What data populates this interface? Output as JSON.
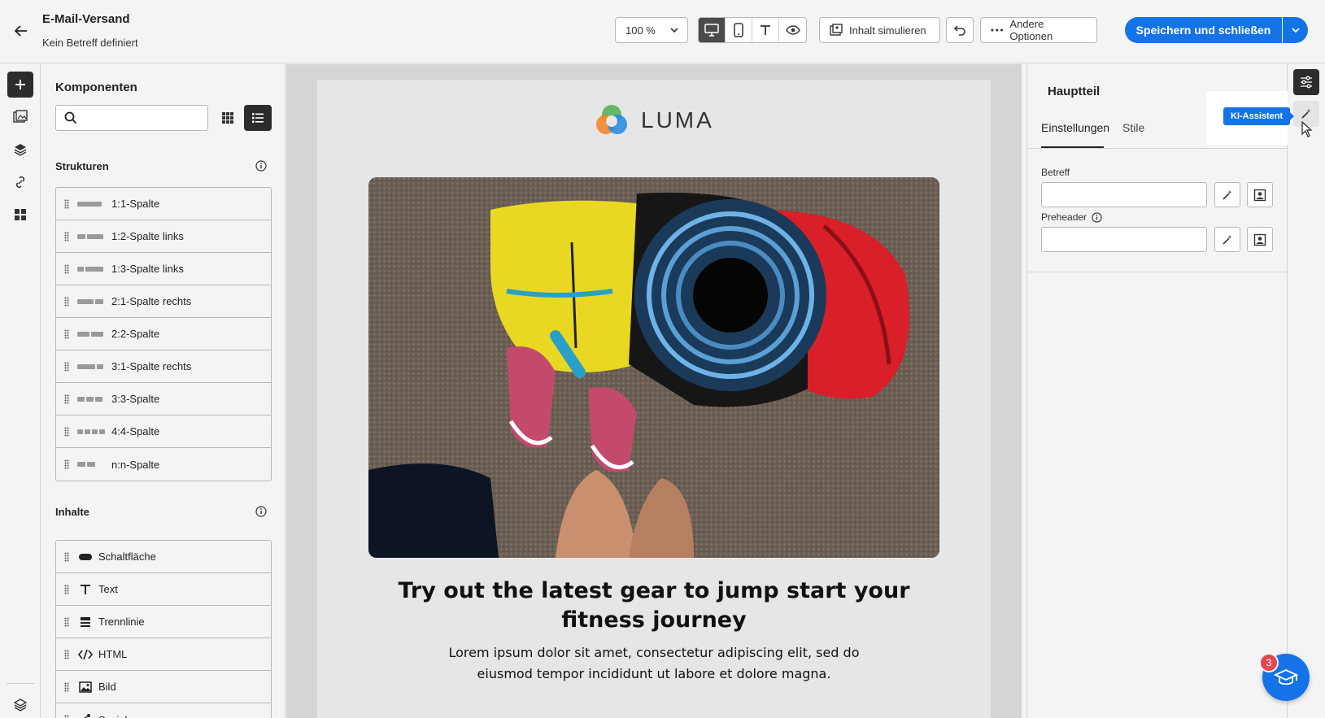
{
  "header": {
    "title": "E-Mail-Versand",
    "subtitle": "Kein Betreff definiert",
    "zoom": "100 %",
    "simulate_label": "Inhalt simulieren",
    "more_options_label": "Andere Optionen",
    "save_label": "Speichern und schließen"
  },
  "components": {
    "title": "Komponenten",
    "search_placeholder": "",
    "structures_heading": "Strukturen",
    "structures": [
      {
        "label": "1:1-Spalte",
        "bars": [
          30
        ]
      },
      {
        "label": "1:2-Spalte links",
        "bars": [
          10,
          20
        ]
      },
      {
        "label": "1:3-Spalte links",
        "bars": [
          8,
          22
        ]
      },
      {
        "label": "2:1-Spalte rechts",
        "bars": [
          20,
          10
        ]
      },
      {
        "label": "2:2-Spalte",
        "bars": [
          15,
          15
        ]
      },
      {
        "label": "3:1-Spalte rechts",
        "bars": [
          22,
          8
        ]
      },
      {
        "label": "3:3-Spalte",
        "bars": [
          9,
          9,
          9
        ]
      },
      {
        "label": "4:4-Spalte",
        "bars": [
          7,
          7,
          7,
          7
        ]
      },
      {
        "label": "n:n-Spalte",
        "bars": [
          10,
          10
        ]
      }
    ],
    "contents_heading": "Inhalte",
    "contents": [
      {
        "label": "Schaltfläche",
        "icon": "button-icon"
      },
      {
        "label": "Text",
        "icon": "text-icon"
      },
      {
        "label": "Trennlinie",
        "icon": "divider-icon"
      },
      {
        "label": "HTML",
        "icon": "html-icon"
      },
      {
        "label": "Bild",
        "icon": "image-icon"
      },
      {
        "label": "Social",
        "icon": "social-icon"
      }
    ]
  },
  "email": {
    "logo_text": "LUMA",
    "headline": "Try out the latest gear to jump start your fitness journey",
    "body": "Lorem ipsum dolor sit amet, consectetur adipiscing elit, sed do eiusmod tempor incididunt ut labore et dolore magna."
  },
  "properties": {
    "title": "Hauptteil",
    "tabs": [
      "Einstellungen",
      "Stile"
    ],
    "subject_label": "Betreff",
    "subject_value": "",
    "preheader_label": "Preheader",
    "preheader_value": ""
  },
  "right_rail": {
    "tooltip": "KI-Assistent"
  },
  "help": {
    "badge_count": "3"
  },
  "colors": {
    "accent": "#1473e6",
    "badge": "#e34850"
  }
}
